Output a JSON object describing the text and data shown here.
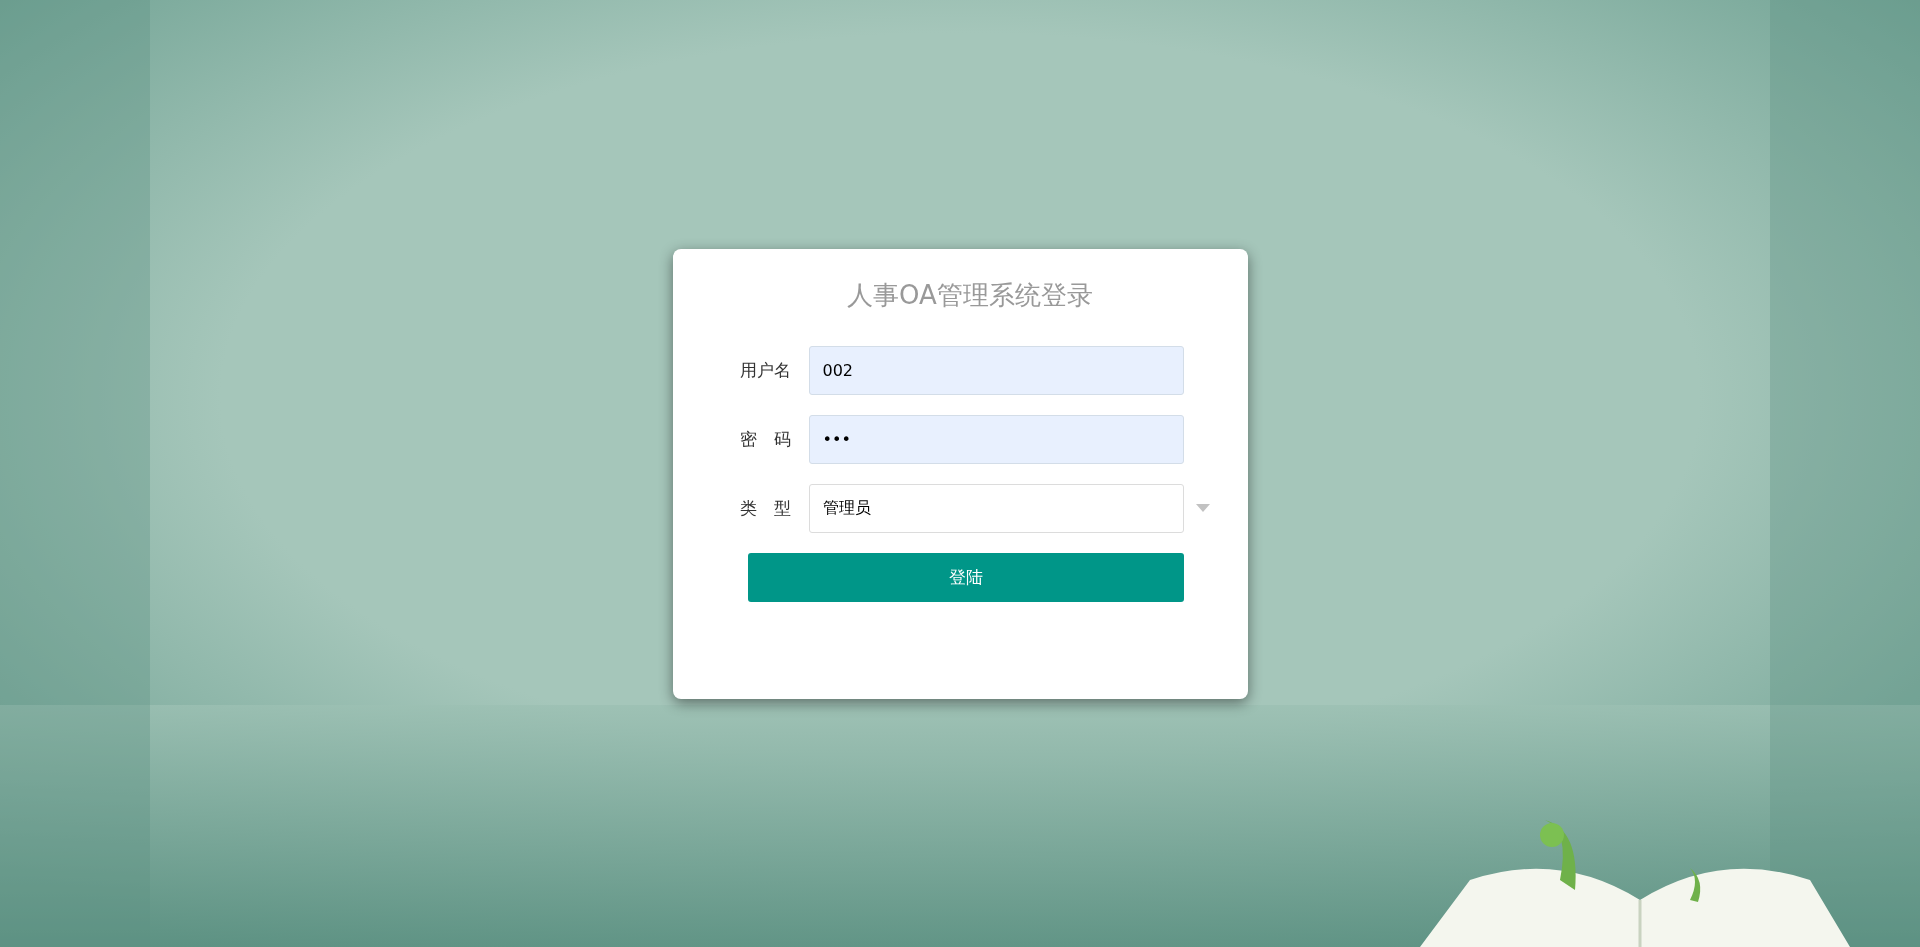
{
  "title": "人事OA管理系统登录",
  "fields": [
    {
      "kind": "text",
      "label": "用户名",
      "value": "002"
    },
    {
      "kind": "password",
      "label": "密　码",
      "value": "•••"
    },
    {
      "kind": "select",
      "label": "类　型",
      "value": "管理员"
    }
  ],
  "button": "登陆"
}
